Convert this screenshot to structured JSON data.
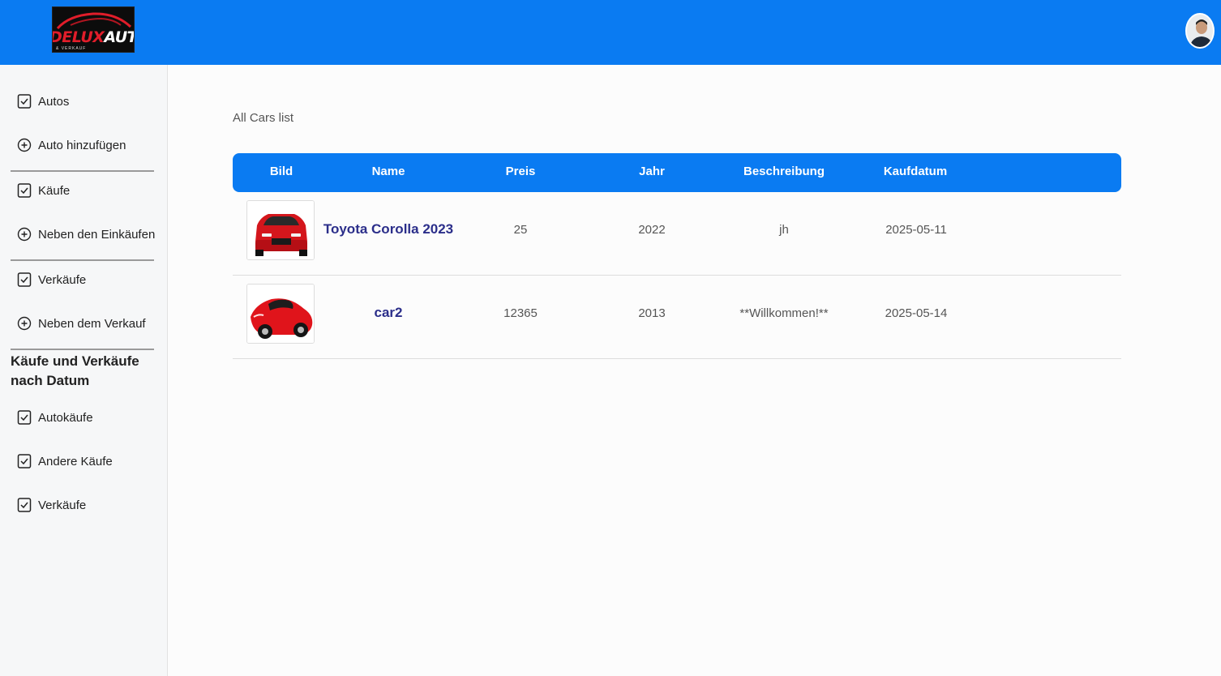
{
  "brand": {
    "logo_red": "DELUX",
    "logo_white": "AUTO",
    "logo_sub": "& VERKAUF"
  },
  "sidebar": {
    "items": [
      {
        "label": "Autos",
        "icon": "checkbox-icon"
      },
      {
        "label": "Auto hinzufügen",
        "icon": "plus-circle-icon"
      },
      {
        "label": "Käufe",
        "icon": "checkbox-icon"
      },
      {
        "label": "Neben den Einkäufen",
        "icon": "plus-circle-icon"
      },
      {
        "label": "Verkäufe",
        "icon": "checkbox-icon"
      },
      {
        "label": "Neben dem Verkauf",
        "icon": "plus-circle-icon"
      }
    ],
    "section_heading": "Käufe und Verkäufe nach Datum",
    "section_items": [
      {
        "label": "Autokäufe",
        "icon": "checkbox-icon"
      },
      {
        "label": "Andere Käufe",
        "icon": "checkbox-icon"
      },
      {
        "label": "Verkäufe",
        "icon": "checkbox-icon"
      }
    ]
  },
  "main": {
    "page_label": "All Cars list",
    "columns": [
      "Bild",
      "Name",
      "Preis",
      "Jahr",
      "Beschreibung",
      "Kaufdatum"
    ],
    "rows": [
      {
        "image": "red-suv-image",
        "name": "Toyota Corolla 2023",
        "preis": "25",
        "jahr": "2022",
        "beschreibung": "jh",
        "kaufdatum": "2025-05-11"
      },
      {
        "image": "red-sports-car-image",
        "name": "car2",
        "preis": "12365",
        "jahr": "2013",
        "beschreibung": "**Willkommen!**",
        "kaufdatum": "2025-05-14"
      }
    ]
  },
  "colors": {
    "primary": "#0a7bf2",
    "name_text": "#2b2e8a",
    "logo_red": "#e11d2a"
  }
}
